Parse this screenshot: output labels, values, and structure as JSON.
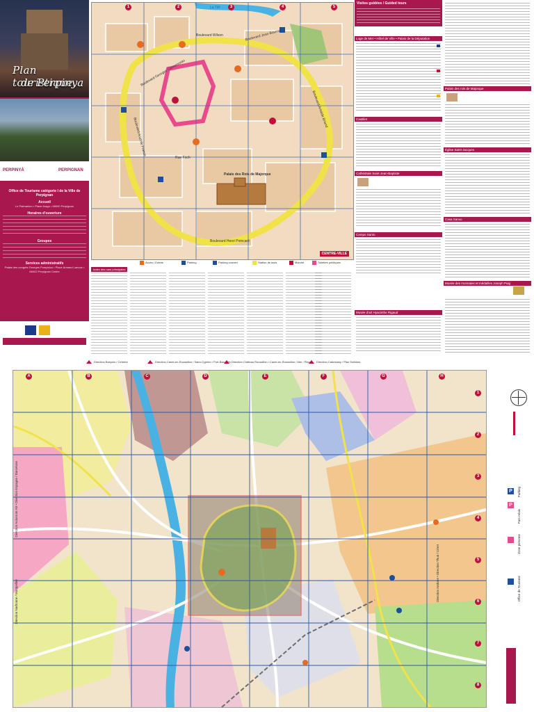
{
  "cover": {
    "title_line1": "Plan touristique",
    "title_line2": "de Perpinya",
    "logo_left": "PERPINYÀ",
    "logo_right": "PERPIGNAN",
    "office_heading": "Office de Tourisme catégorie I de la Ville de Perpignan",
    "address_heading": "Accueil",
    "address": "Le Palmarium • Place Arago • 66000 Perpignan",
    "hours_heading": "Horaires d'ouverture",
    "groups_heading": "Groupes",
    "admin_heading": "Services administratifs",
    "admin_address": "Palais des congrès Georges Pompidou • Place Armand Lanoux • 66002 Perpignan Cedex"
  },
  "center_map": {
    "grid_numbers": [
      "1",
      "2",
      "3",
      "4",
      "5"
    ],
    "labels": [
      "Boulevard Georges Clemenceau",
      "Boulevard Jean Bourrat",
      "Boulevard Wilson",
      "Boulevard Henri Poincaré",
      "Boulevard Aristide Briand",
      "Palais des Rois de Majorque",
      "La Têt",
      "Boulevard Anatole France",
      "Rue Foch"
    ],
    "centre_badge": "CENTRE-VILLE"
  },
  "legend": {
    "items": [
      "Accès / Entrée",
      "Parking",
      "Parking couvert",
      "Station de taxis",
      "Marché",
      "Toilettes publiques"
    ]
  },
  "street_index": {
    "title": "Index des rues principales"
  },
  "info": {
    "guided_title": "Visites guidées / Guided tours",
    "sections": [
      "Loge de Mer • Hôtel de Ville • Palais de la Députation",
      "Castillet",
      "Cathédrale Saint-Jean-Baptiste",
      "Campo Santo",
      "Musée d'art Hyacinthe Rigaud",
      "Palais des rois de Majorque",
      "Église Saint-Jacques",
      "Casa Xanxo",
      "Musée des monnaies et médailles Joseph Puig"
    ]
  },
  "directions": {
    "items": [
      "Direction Banyuls / Cerbère",
      "Direction Canet-en-Roussillon / Saint-Cyprien / Port-Barcarès",
      "Direction Château Roussillon / Canet-en-Roussillon / Mer / Plages",
      "Direction Cabestany / Plaz Solinkes"
    ]
  },
  "big_map": {
    "grid_letters": [
      "A",
      "B",
      "C",
      "D",
      "E",
      "F",
      "G",
      "H"
    ],
    "grid_numbers": [
      "1",
      "2",
      "3",
      "4",
      "5",
      "6",
      "7",
      "8"
    ],
    "legend_texts": [
      "Parking",
      "Parc relais",
      "Zone piétonne",
      "Office de Tourisme"
    ],
    "side_texts": [
      "Direction Autoroute A9 • Direction Espagne / Barcelone",
      "Direction Narbonne / Montpellier",
      "Direction Andorre • Direction Thuir / Céret"
    ]
  },
  "colors": {
    "brand": "#a8174e",
    "marker": "#c0103a",
    "ring_road": "#f2e24a",
    "river": "#4ab2e3",
    "parking": "#1c4f9c"
  }
}
